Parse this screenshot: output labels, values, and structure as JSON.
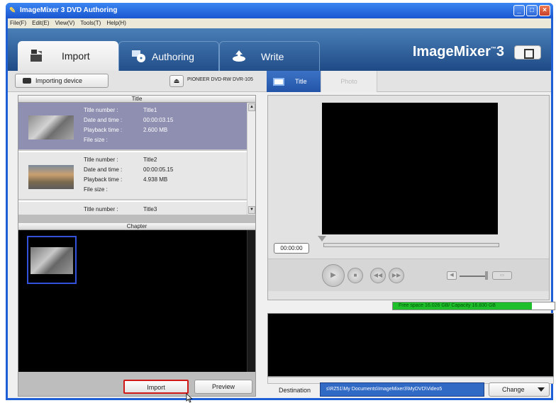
{
  "window": {
    "title": "ImageMixer 3 DVD Authoring"
  },
  "menu": [
    "File(F)",
    "Edit(E)",
    "View(V)",
    "Tools(T)",
    "Help(H)"
  ],
  "tabs": [
    {
      "label": "Import",
      "active": true,
      "icon": "import-icon"
    },
    {
      "label": "Authoring",
      "active": false,
      "icon": "authoring-icon"
    },
    {
      "label": "Write",
      "active": false,
      "icon": "write-icon"
    }
  ],
  "brand": {
    "logo_text": "ImageMixer",
    "logo_superscript": "™",
    "logo_version": "3"
  },
  "toolbar": {
    "importing_device_label": "Importing device",
    "drive_name": "PIONEER DVD-RW  DVR-105",
    "eject_symbol": "⏏",
    "subtab_title": "Title",
    "subtab_photo": "Photo"
  },
  "title_panel": {
    "header": "Title",
    "field_labels": [
      "Title number :",
      "Date and time :",
      "Playback time :",
      "File size :"
    ],
    "items": [
      {
        "title_number": "Title1",
        "date_time": "",
        "playback_time": "00:00:03.15",
        "file_size": "2.600 MB"
      },
      {
        "title_number": "Title2",
        "date_time": "",
        "playback_time": "00:00:05.15",
        "file_size": "4.938 MB"
      },
      {
        "title_number": "Title3",
        "date_time": "",
        "playback_time": "",
        "file_size": ""
      }
    ]
  },
  "chapter_panel": {
    "header": "Chapter"
  },
  "actions": {
    "import_label": "Import",
    "preview_label": "Preview"
  },
  "player": {
    "timecode": "00:00:00"
  },
  "storage": {
    "free_space_text": "Free space 16.026 GB/ Capacity 16.830 GB",
    "free_fraction": 0.86
  },
  "destination": {
    "label": "Destination",
    "path": "s\\RZ51\\My Documents\\ImageMixer3\\MyDVD\\Video5",
    "change_label": "Change"
  },
  "colors": {
    "accent": "#316ac5",
    "selection": "#8f8fb1",
    "highlight_border": "#d01818",
    "free_bar": "#1fbf2c"
  }
}
